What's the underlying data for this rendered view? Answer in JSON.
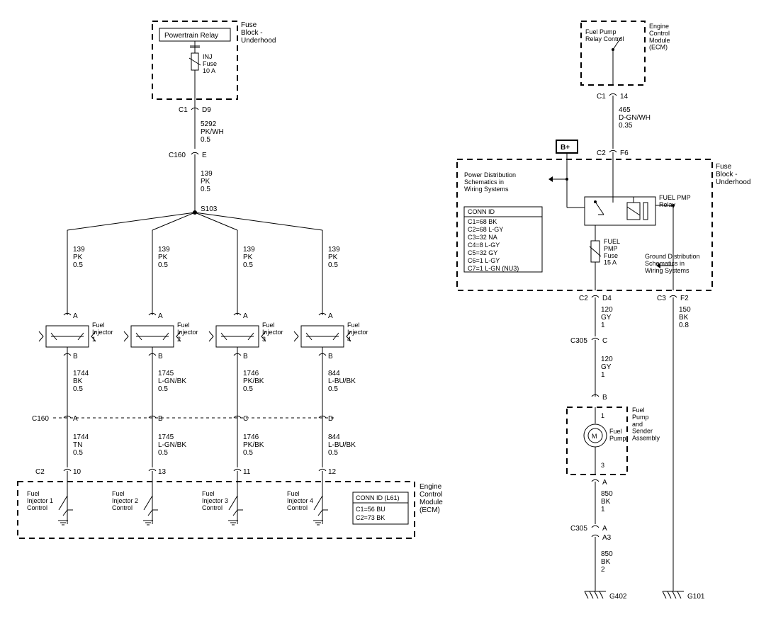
{
  "left": {
    "fuseBlock": {
      "label": "Fuse\nBlock -\nUnderhood",
      "relayLabel": "Powertrain Relay",
      "fuseLabel": "INJ\nFuse\n10 A"
    },
    "connTop": {
      "left": "C1",
      "right": "D9"
    },
    "wireTop": "5292\nPK/WH\n0.5",
    "c160": {
      "left": "C160",
      "right": "E"
    },
    "wireMid": "139\nPK\n0.5",
    "splice": "S103",
    "branchWire": "139\nPK\n0.5",
    "injectors": [
      {
        "name": "Fuel\nInjector\n1",
        "pinTop": "A",
        "pinBot": "B",
        "wireBot1": "1744\nBK\n0.5",
        "c160pin": "A",
        "wireBot2": "1744\nTN\n0.5",
        "c2pin": "10",
        "ecmLabel": "Fuel\nInjector 1\nControl"
      },
      {
        "name": "Fuel\nInjector\n2",
        "pinTop": "A",
        "pinBot": "B",
        "wireBot1": "1745\nL-GN/BK\n0.5",
        "c160pin": "B",
        "wireBot2": "1745\nL-GN/BK\n0.5",
        "c2pin": "13",
        "ecmLabel": "Fuel\nInjector 2\nControl"
      },
      {
        "name": "Fuel\nInjector\n3",
        "pinTop": "A",
        "pinBot": "B",
        "wireBot1": "1746\nPK/BK\n0.5",
        "c160pin": "C",
        "wireBot2": "1746\nPK/BK\n0.5",
        "c2pin": "11",
        "ecmLabel": "Fuel\nInjector 3\nControl"
      },
      {
        "name": "Fuel\nInjector\n4",
        "pinTop": "A",
        "pinBot": "B",
        "wireBot1": "844\nL-BU/BK\n0.5",
        "c160pin": "D",
        "wireBot2": "844\nL-BU/BK\n0.5",
        "c2pin": "12",
        "ecmLabel": "Fuel\nInjector 4\nControl"
      }
    ],
    "c160Label": "C160",
    "c2Label": "C2",
    "ecmBox": {
      "label": "Engine\nControl\nModule\n(ECM)",
      "connId": {
        "title": "CONN ID (L61)",
        "lines": [
          "C1=56 BU",
          "C2=73 BK"
        ]
      }
    }
  },
  "right": {
    "ecmTop": {
      "label": "Engine\nControl\nModule\n(ECM)",
      "inner": "Fuel Pump\nRelay Control"
    },
    "c1": {
      "left": "C1",
      "right": "14"
    },
    "wire1": "465\nD-GN/WH\n0.35",
    "bplus": "B+",
    "c2": {
      "left": "C2",
      "right": "F6"
    },
    "fuseBox": {
      "label": "Fuse\nBlock -\nUnderhood",
      "pdLabel": "Power Distribution\nSchematics in\nWiring Systems",
      "gdLabel": "Ground Distribution\nSchematics in\nWiring Systems",
      "relay": "FUEL PMP\nRelay",
      "fuse": "FUEL\nPMP\nFuse\n15 A",
      "connId": {
        "title": "CONN ID",
        "lines": [
          "C1=68 BK",
          "C2=68 L-GY",
          "C3=32 NA",
          "C4=8 L-GY",
          "C5=32 GY",
          "C6=1 L-GY",
          "C7=1 L-GN (NU3)"
        ]
      }
    },
    "connBot": {
      "c2l": "C2",
      "c2r": "D4",
      "c3l": "C3",
      "c3r": "F2"
    },
    "wire2": "120\nGY\n1",
    "wireGnd": "150\nBK\n0.8",
    "c305a": {
      "left": "C305",
      "right": "C"
    },
    "wire3": "120\nGY\n1",
    "pinB": "B",
    "pumpBox": {
      "label": "Fuel\nPump\nand\nSender\nAssembly",
      "pump": "Fuel\nPump",
      "pin1": "1",
      "pin3": "3"
    },
    "pinA": "A",
    "wire4": "850\nBK\n1",
    "c305b": {
      "left": "C305",
      "right": "A",
      "right2": "A3"
    },
    "wire5": "850\nBK\n2",
    "g402": "G402",
    "g101": "G101"
  }
}
